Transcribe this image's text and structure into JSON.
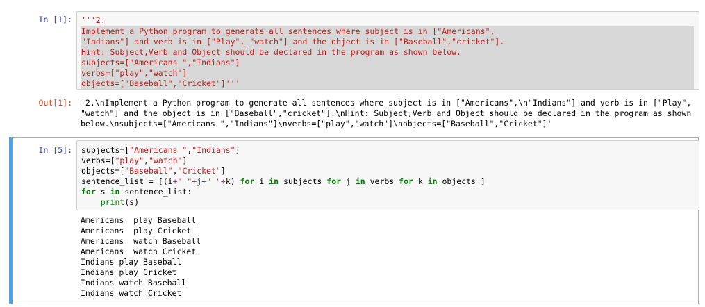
{
  "cell1": {
    "prompt": "In [1]:",
    "lines": [
      "'''2.",
      "Implement a Python program to generate all sentences where subject is in [\"Americans\",",
      "\"Indians\"] and verb is in [\"Play\", \"watch\"] and the object is in [\"Baseball\",\"cricket\"].",
      "Hint: Subject,Verb and Object should be declared in the program as shown below.",
      "subjects=[\"Americans \",\"Indians\"]",
      "verbs=[\"play\",\"watch\"]",
      "objects=[\"Baseball\",\"Cricket\"]'''"
    ]
  },
  "out1": {
    "prompt": "Out[1]:",
    "lines": [
      "'2.\\nImplement a Python program to generate all sentences where subject is in [\"Americans\",\\n\"Indians\"] and verb is in [\"Play\",",
      "\"watch\"] and the object is in [\"Baseball\",\"cricket\"].\\nHint: Subject,Verb and Object should be declared in the program as shown",
      "below.\\nsubjects=[\"Americans \",\"Indians\"]\\nverbs=[\"play\",\"watch\"]\\nobjects=[\"Baseball\",\"Cricket\"]'"
    ]
  },
  "cell5": {
    "prompt": "In [5]:",
    "code": {
      "l1a": "subjects=",
      "l1b": "[",
      "l1c": "\"Americans \"",
      "l1d": ",",
      "l1e": "\"Indians\"",
      "l1f": "]",
      "l2a": "verbs=",
      "l2b": "[",
      "l2c": "\"play\"",
      "l2d": ",",
      "l2e": "\"watch\"",
      "l2f": "]",
      "l3a": "objects=",
      "l3b": "[",
      "l3c": "\"Baseball\"",
      "l3d": ",",
      "l3e": "\"Cricket\"",
      "l3f": "]",
      "l4a": "sentence_list = [(i",
      "l4b": "+",
      "l4c": "\" \"",
      "l4d": "+",
      "l4e": "j",
      "l4f": "+",
      "l4g": "\" \"",
      "l4h": "+",
      "l4i": "k) ",
      "l4j": "for",
      "l4k": " i ",
      "l4l": "in",
      "l4m": " subjects ",
      "l4n": "for",
      "l4o": " j ",
      "l4p": "in",
      "l4q": " verbs ",
      "l4r": "for",
      "l4s": " k ",
      "l4t": "in",
      "l4u": " objects ]",
      "l5a": "for",
      "l5b": " s ",
      "l5c": "in",
      "l5d": " sentence_list:",
      "l6a": "    ",
      "l6b": "print",
      "l6c": "(s)"
    },
    "output": [
      "Americans  play Baseball",
      "Americans  play Cricket",
      "Americans  watch Baseball",
      "Americans  watch Cricket",
      "Indians play Baseball",
      "Indians play Cricket",
      "Indians watch Baseball",
      "Indians watch Cricket"
    ]
  },
  "colors": {
    "in_prompt": "#303f9f",
    "out_prompt": "#d84315",
    "string": "#ba2121",
    "keyword": "#008000",
    "selected_bar": "#42a5f5"
  }
}
